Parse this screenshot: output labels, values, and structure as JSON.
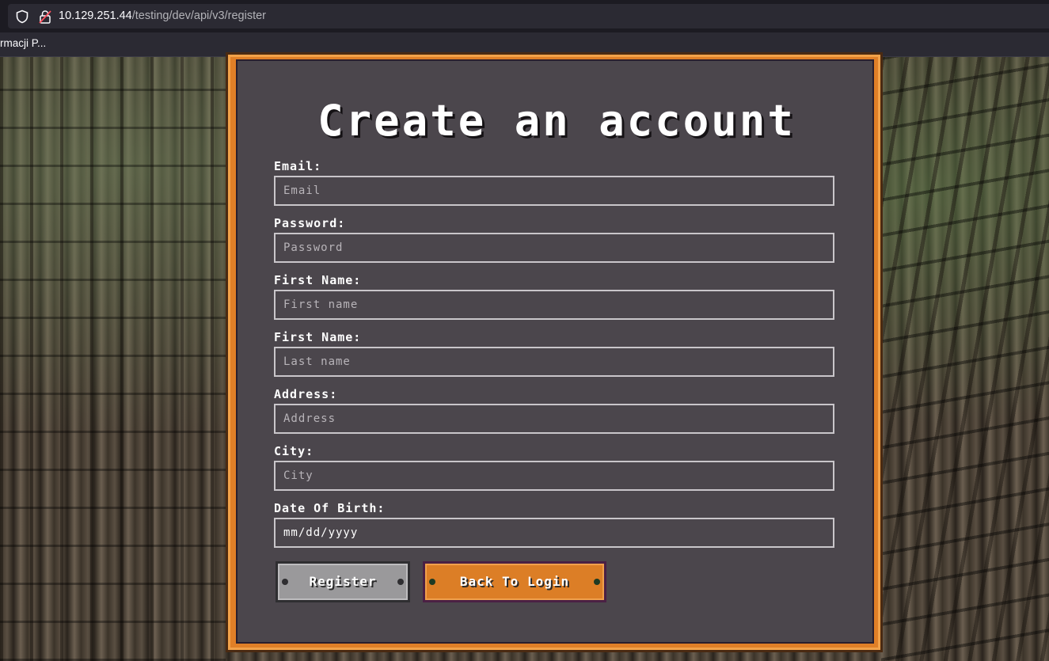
{
  "browser": {
    "url_host": "10.129.251.44",
    "url_path": "/testing/dev/api/v3/register",
    "bookmark": "rmacji P..."
  },
  "form": {
    "title": "Create an account",
    "fields": [
      {
        "label": "Email:",
        "placeholder": "Email"
      },
      {
        "label": "Password:",
        "placeholder": "Password"
      },
      {
        "label": "First Name:",
        "placeholder": "First name"
      },
      {
        "label": "First Name:",
        "placeholder": "Last name"
      },
      {
        "label": "Address:",
        "placeholder": "Address"
      },
      {
        "label": "City:",
        "placeholder": "City"
      },
      {
        "label": "Date Of Birth:",
        "value": "mm/dd/yyyy"
      }
    ],
    "register_label": "Register",
    "back_label": "Back To Login"
  },
  "colors": {
    "accent_orange": "#dc7e26",
    "card_bg": "#4b464c",
    "register_gray": "#9a999b"
  },
  "icons": [
    "shield-icon",
    "lock-icon",
    "bolt-icon"
  ]
}
